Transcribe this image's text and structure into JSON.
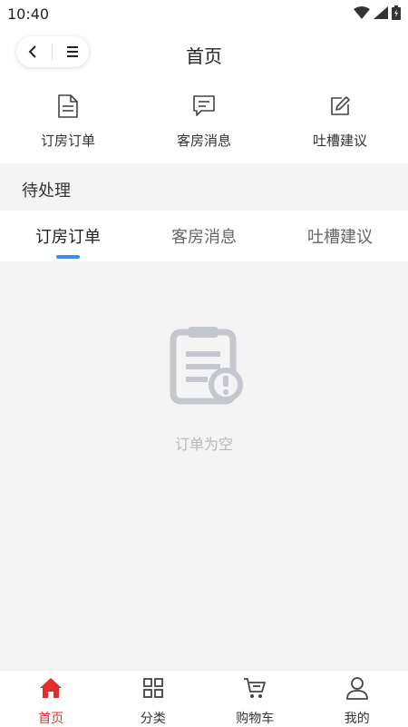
{
  "status": {
    "time": "10:40"
  },
  "header": {
    "title": "首页"
  },
  "quick_actions": [
    {
      "label": "订房订单",
      "icon": "document-icon"
    },
    {
      "label": "客房消息",
      "icon": "message-icon"
    },
    {
      "label": "吐槽建议",
      "icon": "edit-icon"
    }
  ],
  "section": {
    "title": "待处理"
  },
  "tabs": [
    {
      "label": "订房订单",
      "active": true
    },
    {
      "label": "客房消息",
      "active": false
    },
    {
      "label": "吐槽建议",
      "active": false
    }
  ],
  "empty": {
    "text": "订单为空"
  },
  "tabbar": [
    {
      "label": "首页",
      "icon": "home-icon",
      "active": true
    },
    {
      "label": "分类",
      "icon": "grid-icon",
      "active": false
    },
    {
      "label": "购物车",
      "icon": "cart-icon",
      "active": false
    },
    {
      "label": "我的",
      "icon": "user-icon",
      "active": false
    }
  ],
  "colors": {
    "accent": "#e0302b",
    "tab_underline": "#3f8dea",
    "background": "#f4f4f5"
  }
}
